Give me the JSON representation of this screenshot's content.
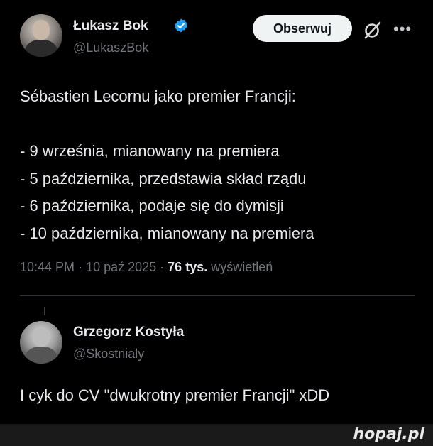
{
  "tweet": {
    "author_name": "Łukasz Bok",
    "author_handle": "@LukaszBok",
    "follow_label": "Obserwuj",
    "lines": [
      "Sébastien Lecornu jako premier Francji:",
      "",
      "- 9 września, mianowany na premiera",
      "- 5 października, przedstawia skład rządu",
      "- 6 października, podaje się do dymisji",
      "- 10 października, mianowany na premiera"
    ],
    "time": "10:44 PM",
    "date": "10 paź 2025",
    "views_count": "76 tys.",
    "views_label": "wyświetleń"
  },
  "reply": {
    "author_name": "Grzegorz Kostyła",
    "author_handle": "@Skostnialy",
    "text": "I cyk do CV \"dwukrotny premier Francji\" xDD"
  },
  "footer": {
    "logo": "hopaj.pl"
  },
  "icons": {
    "verified": "verified-badge-icon",
    "grok": "grok-icon",
    "more": "more-icon"
  },
  "colors": {
    "verified": "#1d9bf0",
    "background": "#000000",
    "muted": "#71767b"
  }
}
